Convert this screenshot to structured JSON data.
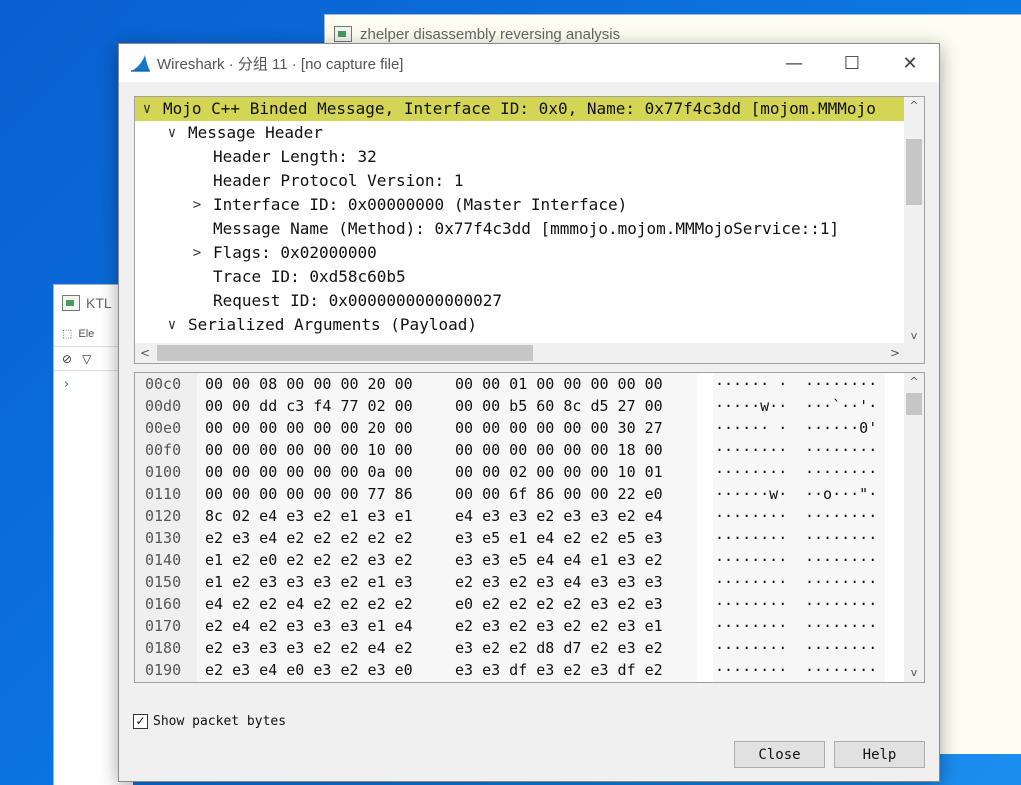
{
  "bg_window_1": {
    "title": "zhelper disassembly reversing analysis",
    "icon": "app-window-icon"
  },
  "bg_window_2": {
    "title": "KTL",
    "tool_label": "Ele",
    "icon": "app-window-icon"
  },
  "dialog": {
    "title": "Wireshark · 分组 11 · [no capture file]",
    "icon": "wireshark-fin-icon",
    "controls": {
      "minimize": "—",
      "maximize": "☐",
      "close": "✕"
    }
  },
  "tree": {
    "rows": [
      {
        "exp": "∨",
        "text": "Mojo C++ Binded Message, Interface ID: 0x0, Name: 0x77f4c3dd [mojom.MMMojo",
        "selected": true
      },
      {
        "exp": "∨",
        "text": "Message Header"
      },
      {
        "exp": "",
        "text": "Header Length: 32"
      },
      {
        "exp": "",
        "text": "Header Protocol Version: 1"
      },
      {
        "exp": ">",
        "text": "Interface ID: 0x00000000 (Master Interface)"
      },
      {
        "exp": "",
        "text": "Message Name (Method): 0x77f4c3dd [mmmojo.mojom.MMMojoService::1]"
      },
      {
        "exp": ">",
        "text": "Flags: 0x02000000"
      },
      {
        "exp": "",
        "text": "Trace ID: 0xd58c60b5"
      },
      {
        "exp": "",
        "text": "Request ID: 0x0000000000000027"
      },
      {
        "exp": "∨",
        "text": "Serialized Arguments (Payload)"
      }
    ],
    "scroll": {
      "up": "^",
      "down": "v",
      "left": "<",
      "right": ">"
    }
  },
  "bytes": {
    "rows": [
      {
        "off": "00c0",
        "h1": "00 00 08 00 00 00 20 00",
        "h2": "00 00 01 00 00 00 00 00",
        "a1": "······ ·",
        "a2": "········"
      },
      {
        "off": "00d0",
        "h1": "00 00 dd c3 f4 77 02 00",
        "h2": "00 00 b5 60 8c d5 27 00",
        "a1": "·····w··",
        "a2": "···`··'·"
      },
      {
        "off": "00e0",
        "h1": "00 00 00 00 00 00 20 00",
        "h2": "00 00 00 00 00 00 30 27",
        "a1": "······ ·",
        "a2": "······0'"
      },
      {
        "off": "00f0",
        "h1": "00 00 00 00 00 00 10 00",
        "h2": "00 00 00 00 00 00 18 00",
        "a1": "········",
        "a2": "········"
      },
      {
        "off": "0100",
        "h1": "00 00 00 00 00 00 0a 00",
        "h2": "00 00 02 00 00 00 10 01",
        "a1": "········",
        "a2": "········"
      },
      {
        "off": "0110",
        "h1": "00 00 00 00 00 00 77 86",
        "h2": "00 00 6f 86 00 00 22 e0",
        "a1": "······w·",
        "a2": "··o···\"·"
      },
      {
        "off": "0120",
        "h1": "8c 02 e4 e3 e2 e1 e3 e1",
        "h2": "e4 e3 e3 e2 e3 e3 e2 e4",
        "a1": "········",
        "a2": "········"
      },
      {
        "off": "0130",
        "h1": "e2 e3 e4 e2 e2 e2 e2 e2",
        "h2": "e3 e5 e1 e4 e2 e2 e5 e3",
        "a1": "········",
        "a2": "········"
      },
      {
        "off": "0140",
        "h1": "e1 e2 e0 e2 e2 e2 e3 e2",
        "h2": "e3 e3 e5 e4 e4 e1 e3 e2",
        "a1": "········",
        "a2": "········"
      },
      {
        "off": "0150",
        "h1": "e1 e2 e3 e3 e3 e2 e1 e3",
        "h2": "e2 e3 e2 e3 e4 e3 e3 e3",
        "a1": "········",
        "a2": "········"
      },
      {
        "off": "0160",
        "h1": "e4 e2 e2 e4 e2 e2 e2 e2",
        "h2": "e0 e2 e2 e2 e2 e3 e2 e3",
        "a1": "········",
        "a2": "········"
      },
      {
        "off": "0170",
        "h1": "e2 e4 e2 e3 e3 e3 e1 e4",
        "h2": "e2 e3 e2 e3 e2 e2 e3 e1",
        "a1": "········",
        "a2": "········"
      },
      {
        "off": "0180",
        "h1": "e2 e3 e3 e3 e2 e2 e4 e2",
        "h2": "e3 e2 e2 d8 d7 e2 e3 e2",
        "a1": "········",
        "a2": "········"
      },
      {
        "off": "0190",
        "h1": "e2 e3 e4 e0 e3 e2 e3 e0",
        "h2": "e3 e3 df e3 e2 e3 df e2",
        "a1": "········",
        "a2": "········"
      }
    ]
  },
  "show_bytes": {
    "label": "Show packet bytes",
    "checked": true,
    "mark": "✓"
  },
  "buttons": {
    "close": "Close",
    "help": "Help"
  }
}
